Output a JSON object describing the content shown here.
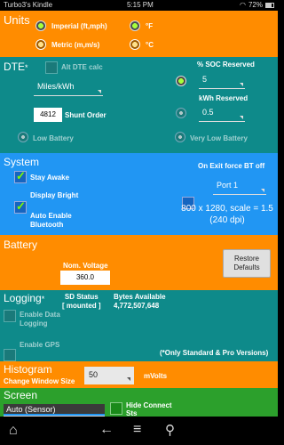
{
  "status": {
    "device": "Turbo3's Kindle",
    "time": "5:15 PM",
    "battery": "72%"
  },
  "units": {
    "title": "Units",
    "imperial": "Imperial (ft,mph)",
    "metric": "Metric (m,m/s)",
    "f": "°F",
    "c": "°C"
  },
  "dte": {
    "title": "DTE",
    "star": "*",
    "alt_calc": "Alt DTE calc",
    "unit_select": "Miles/kWh",
    "shunt_value": "4812",
    "shunt_label": "Shunt Order",
    "low_battery": "Low Battery",
    "soc_label": "% SOC Reserved",
    "soc_value": "5",
    "kwh_label": "kWh Reserved",
    "kwh_value": "0.5",
    "very_low": "Very Low Battery"
  },
  "system": {
    "title": "System",
    "stay_awake": "Stay Awake",
    "display_bright": "Display Bright",
    "auto_bt_1": "Auto Enable",
    "auto_bt_2": "Bluetooth",
    "exit_bt": "On Exit force BT off",
    "port": "Port 1",
    "resolution": "800 x 1280, scale = 1.5",
    "dpi": "(240 dpi)"
  },
  "battery": {
    "title": "Battery",
    "nom_label": "Nom. Voltage",
    "nom_value": "360.0",
    "restore_1": "Restore",
    "restore_2": "Defaults"
  },
  "logging": {
    "title": "Logging",
    "star": "*",
    "sd_label": "SD Status",
    "sd_value": "[ mounted ]",
    "bytes_label": "Bytes Available",
    "bytes_value": "4,772,507,648",
    "enable_data_1": "Enable Data",
    "enable_data_2": "Logging",
    "enable_gps": "Enable GPS",
    "note": "(*Only Standard & Pro Versions)"
  },
  "histogram": {
    "title": "Histogram",
    "sub": "Change Window Size",
    "value": "50",
    "unit": "mVolts"
  },
  "screen": {
    "title": "Screen",
    "select": "Auto (Sensor)",
    "hide_1": "Hide Connect",
    "hide_2": "Sts"
  },
  "colors": {
    "orange": "#ff8c00",
    "teal": "#0e8a8a",
    "blue": "#2196f3",
    "green": "#2ca02c"
  }
}
